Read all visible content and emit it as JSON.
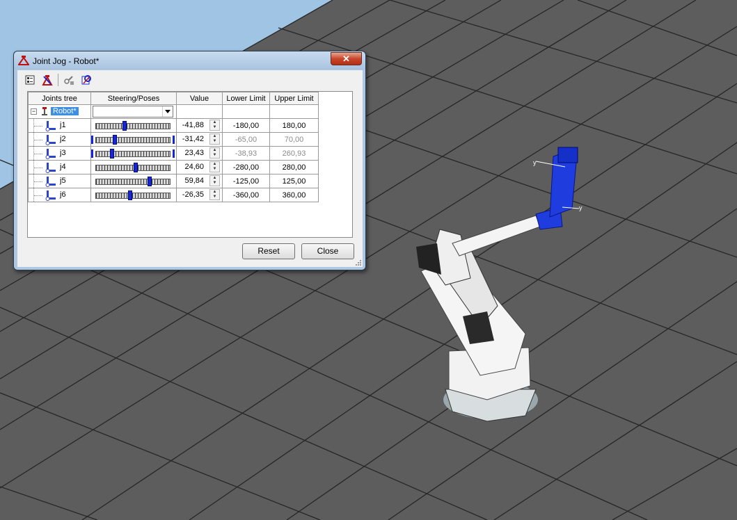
{
  "window": {
    "title": "Joint Jog - Robot*",
    "close_glyph": "✕"
  },
  "toolbar": {
    "icons": [
      "properties-icon",
      "robot-reset-icon",
      "attach-icon",
      "settings-icon"
    ]
  },
  "grid": {
    "columns": [
      "Joints tree",
      "Steering/Poses",
      "Value",
      "Lower Limit",
      "Upper Limit"
    ],
    "robot": {
      "name": "Robot*",
      "pose": ""
    },
    "rows": [
      {
        "joint": "j1",
        "value": "-41,88",
        "lower": "-180,00",
        "upper": "180,00",
        "fraction": 0.384,
        "limits_dimmed": false
      },
      {
        "joint": "j2",
        "value": "-31,42",
        "lower": "-65,00",
        "upper": "70,00",
        "fraction": 0.249,
        "limits_dimmed": true
      },
      {
        "joint": "j3",
        "value": "23,43",
        "lower": "-38,93",
        "upper": "260,93",
        "fraction": 0.208,
        "limits_dimmed": true
      },
      {
        "joint": "j4",
        "value": "24,60",
        "lower": "-280,00",
        "upper": "280,00",
        "fraction": 0.544,
        "limits_dimmed": false
      },
      {
        "joint": "j5",
        "value": "59,84",
        "lower": "-125,00",
        "upper": "125,00",
        "fraction": 0.739,
        "limits_dimmed": false
      },
      {
        "joint": "j6",
        "value": "-26,35",
        "lower": "-360,00",
        "upper": "360,00",
        "fraction": 0.463,
        "limits_dimmed": false
      }
    ]
  },
  "buttons": {
    "reset": "Reset",
    "close": "Close"
  },
  "colors": {
    "floor": "#5a5a5a",
    "sky": "#9fc4e4",
    "accent": "#1428d8",
    "selection": "#3d8ee5"
  }
}
